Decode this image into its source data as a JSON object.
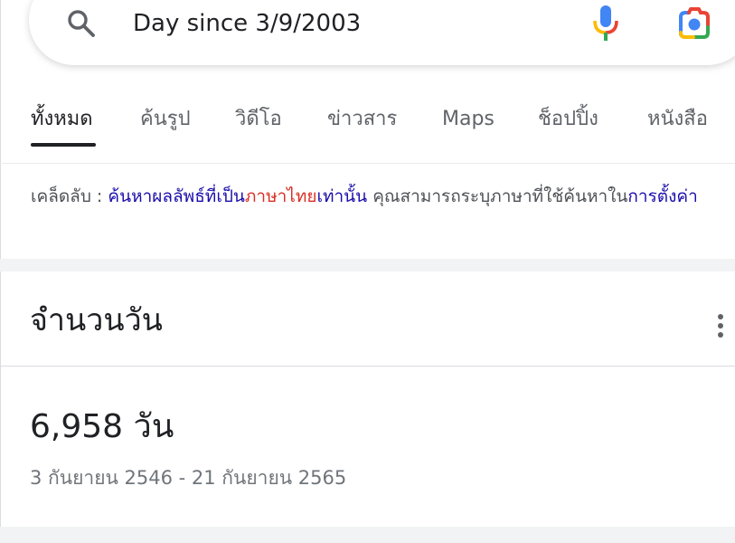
{
  "search": {
    "query": "Day since 3/9/2003"
  },
  "tabs": [
    {
      "label": "ทั้งหมด",
      "active": true
    },
    {
      "label": "ค้นรูป",
      "active": false
    },
    {
      "label": "วิดีโอ",
      "active": false
    },
    {
      "label": "ข่าวสาร",
      "active": false
    },
    {
      "label": "Maps",
      "active": false
    },
    {
      "label": "ช็อปปิ้ง",
      "active": false
    },
    {
      "label": "หนังสือ",
      "active": false
    }
  ],
  "tip": {
    "prefix": "เคล็ดลับ : ",
    "link1_part1": "ค้นหาผลลัพธ์ที่เป็น",
    "link1_part2": "ภาษาไทย",
    "link1_part3": "เท่านั้น",
    "middle": " คุณสามารถระบุภาษาที่ใช้ค้นหาใน",
    "link2": "การตั้งค่า"
  },
  "card": {
    "title": "จำนวนวัน",
    "value": "6,958 วัน",
    "range": "3 กันยายน 2546 - 21 กันยายน 2565"
  },
  "colors": {
    "link_blue": "#1a0dab",
    "link_red": "#d93025",
    "mic_blue": "#4285f4",
    "mic_red": "#ea4335",
    "mic_yellow": "#fbbc04",
    "mic_green": "#34a853",
    "band_gray": "#f1f3f4"
  },
  "icons": {
    "search": "search-icon",
    "mic": "mic-icon",
    "lens": "google-lens-icon",
    "more": "more-vert-icon"
  }
}
